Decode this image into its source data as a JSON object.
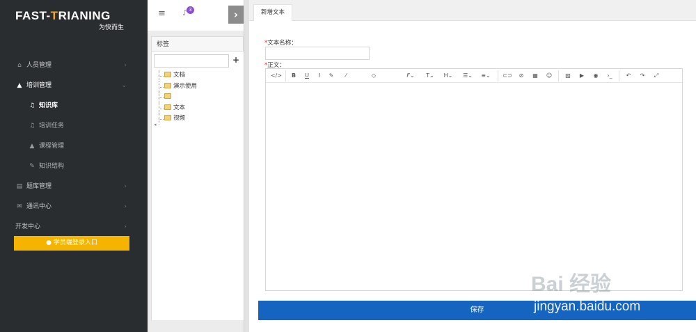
{
  "logo": {
    "brand_left": "FAST-",
    "brand_t": "T",
    "brand_right": "RIANING",
    "slogan": "为快而生"
  },
  "sidebar": {
    "items": [
      {
        "label": "人员管理",
        "icon": "bank-icon"
      },
      {
        "label": "培训管理",
        "icon": "graduation-cap-icon",
        "open": true
      },
      {
        "label": "知识库",
        "icon": "bell-icon",
        "active": true
      },
      {
        "label": "培训任务",
        "icon": "bell-icon"
      },
      {
        "label": "课程管理",
        "icon": "graduation-cap-icon"
      },
      {
        "label": "知识结构",
        "icon": "pencil-icon"
      },
      {
        "label": "题库管理",
        "icon": "book-icon"
      },
      {
        "label": "通讯中心",
        "icon": "envelope-icon"
      },
      {
        "label": "开发中心",
        "icon": ""
      }
    ],
    "login_button": "学员端登录入口"
  },
  "topbar": {
    "notification_count": "3"
  },
  "tag_panel": {
    "header": "标签",
    "search_value": "",
    "add_symbol": "+",
    "tree": [
      "文档",
      "演示使用",
      "",
      "文本",
      "视频"
    ]
  },
  "main": {
    "tab_label": "新增文本",
    "name_label": "文本名称：",
    "name_value": "",
    "body_label": "正文：",
    "save_label": "保存"
  },
  "toolbar_glyphs": {
    "code": "</>",
    "bold": "B",
    "underline": "U",
    "italic": "I",
    "font": "F",
    "size": "T",
    "heading": "H"
  },
  "watermark": {
    "logo_text": "Bai 经验",
    "url": "jingyan.baidu.com"
  },
  "colors": {
    "sidebar_bg": "#2a2d30",
    "login_button": "#f5b400",
    "save_button": "#1565c0",
    "badge": "#8a4fd8",
    "required": "#e0272a"
  }
}
